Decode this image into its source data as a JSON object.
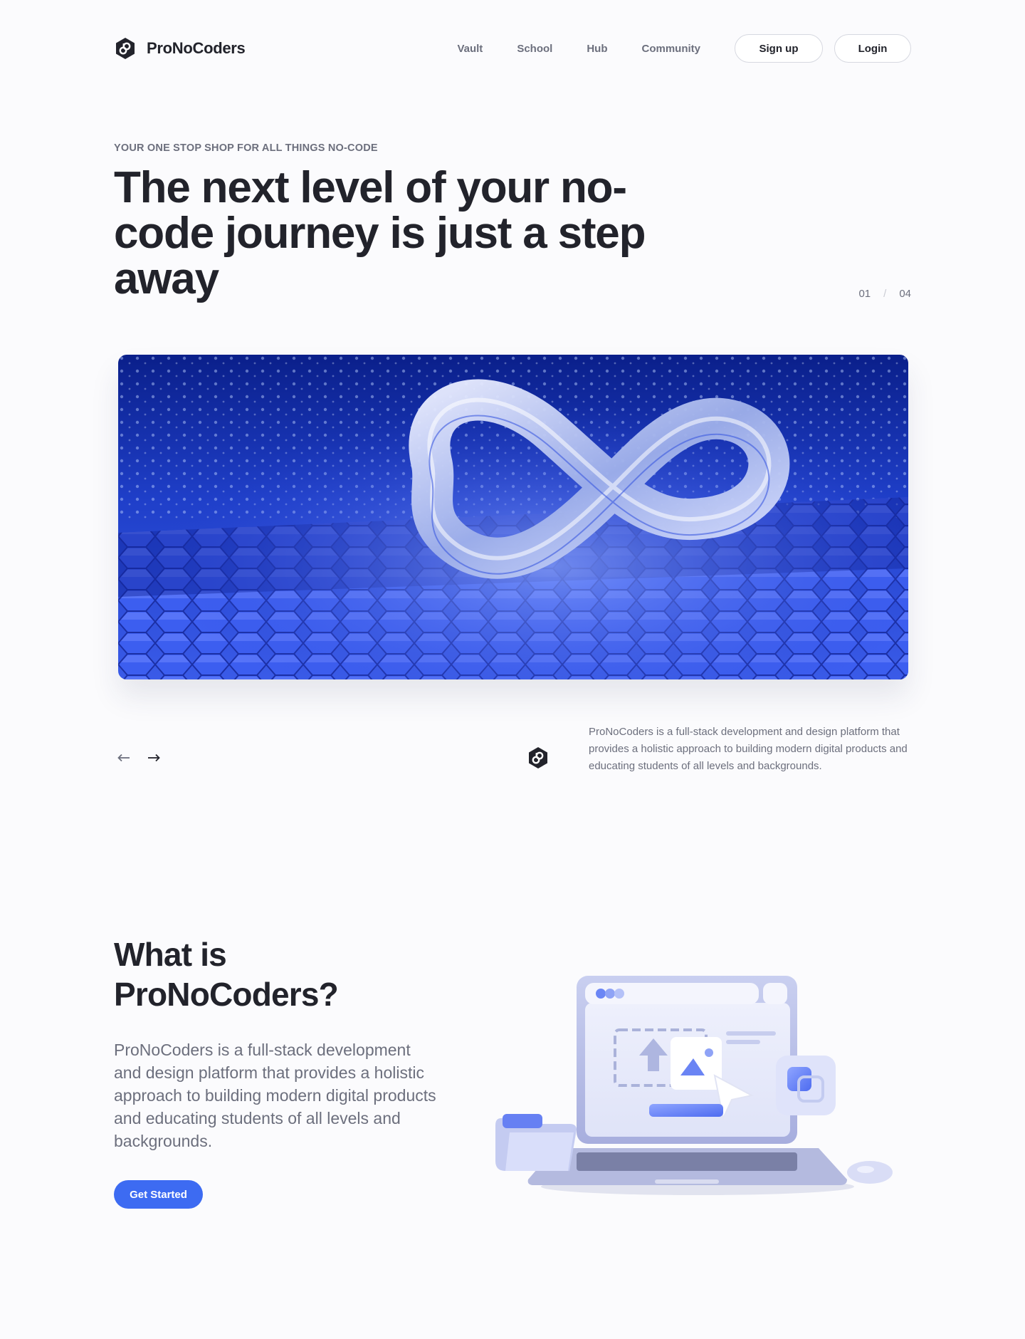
{
  "brand": {
    "name": "ProNoCoders",
    "logo_icon": "pronocoders-hex-logo"
  },
  "nav": {
    "links": [
      "Vault",
      "School",
      "Hub",
      "Community"
    ],
    "signup_label": "Sign up",
    "login_label": "Login"
  },
  "hero": {
    "eyebrow": "YOUR ONE STOP SHOP FOR ALL THINGS NO-CODE",
    "title": "The next level of your no-code journey is just a step away",
    "slide_current": "01",
    "slide_separator": "/",
    "slide_total": "04",
    "image": "blue-infinity-on-hexagon-grid"
  },
  "slider": {
    "prev_icon": "arrow-left-icon",
    "next_icon": "arrow-right-icon",
    "description": "ProNoCoders is a full-stack development and design platform that provides a holistic approach to building modern digital products and educating students of all levels and backgrounds."
  },
  "about": {
    "title": "What is ProNoCoders?",
    "body": "ProNoCoders is a full-stack development and design platform that provides a holistic approach to building modern digital products and educating students of all levels and backgrounds.",
    "cta_label": "Get Started",
    "illustration": "laptop-with-upload-folder-mouse"
  },
  "colors": {
    "text": "#22232b",
    "muted": "#6c6f7d",
    "accent": "#3d6bf2",
    "background": "#fbfbfd"
  }
}
